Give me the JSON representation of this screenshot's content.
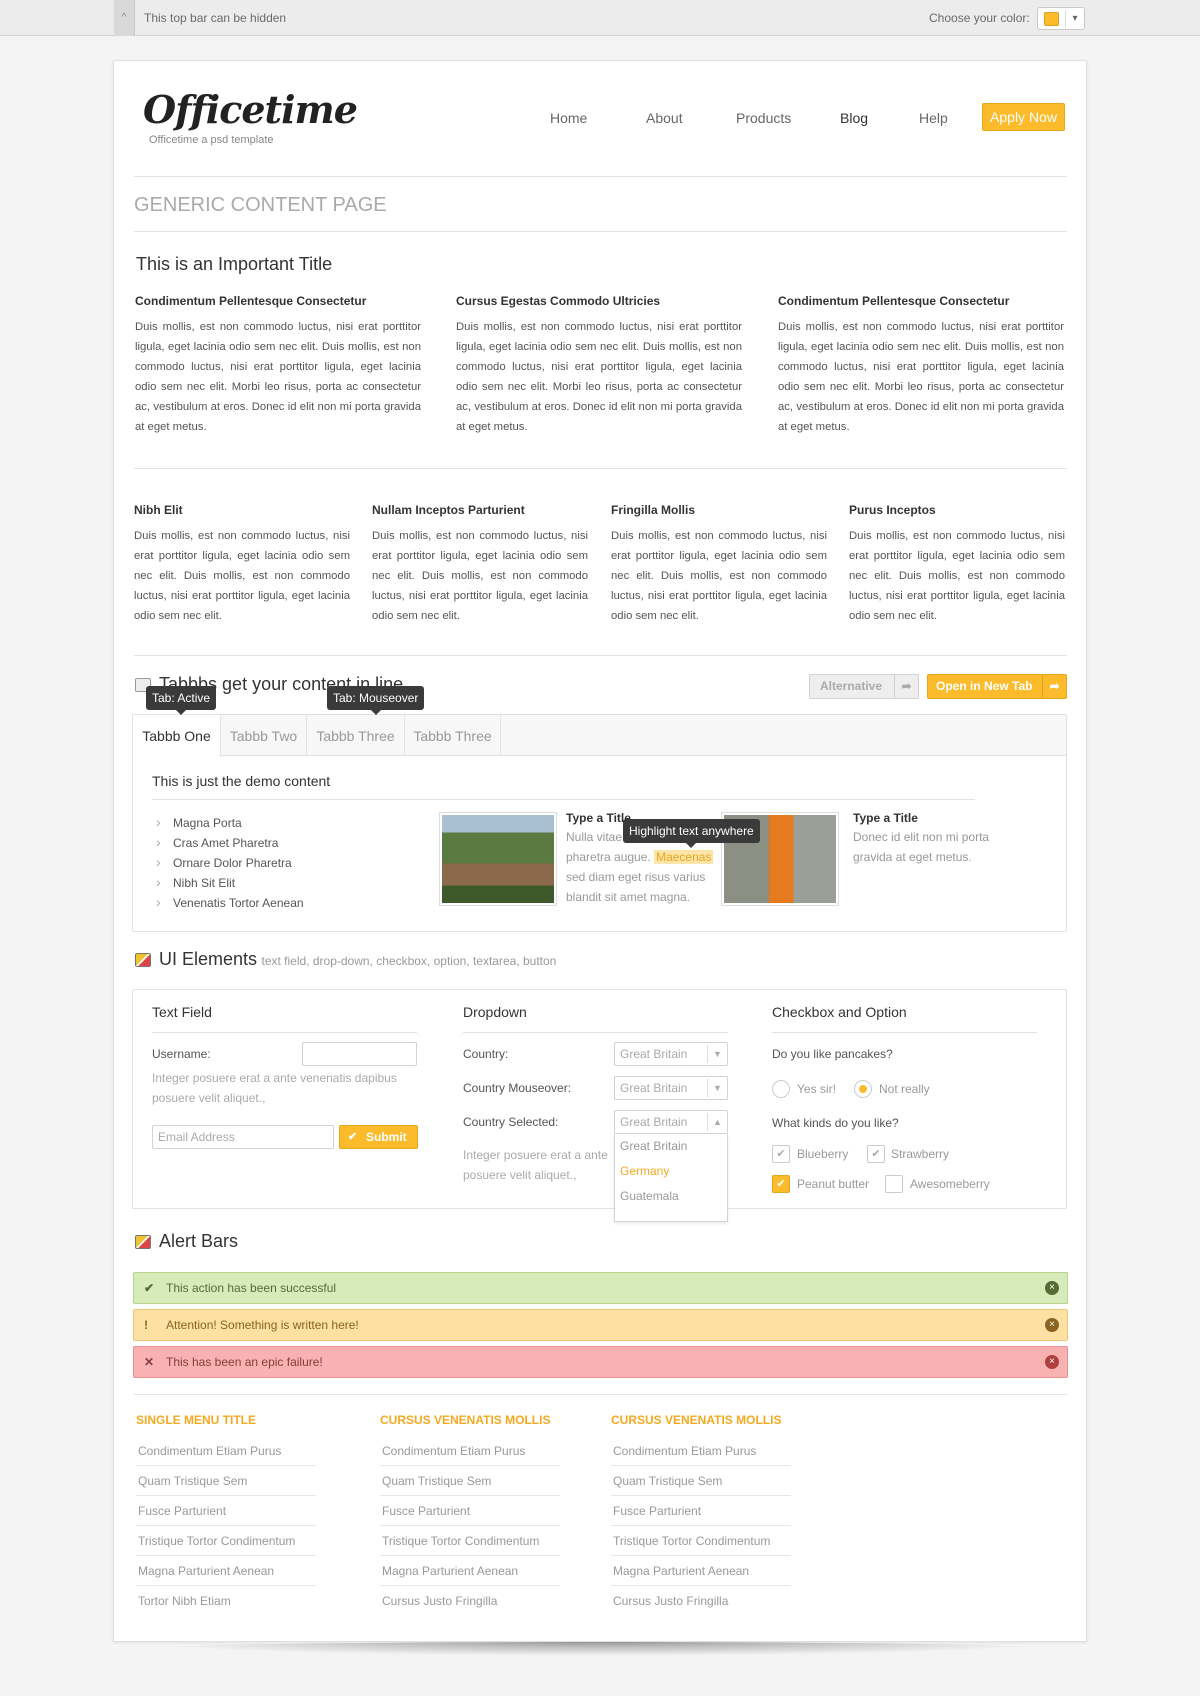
{
  "topbar": {
    "toggle_symbol": "^",
    "text": "This top bar can be hidden",
    "color_label": "Choose your color:",
    "color_value": "#fbbb2b"
  },
  "brand": {
    "name": "Officetime",
    "tagline": "Officetime a psd template"
  },
  "nav": {
    "items": [
      "Home",
      "About",
      "Products",
      "Blog",
      "Help"
    ],
    "active": "Blog",
    "cta": "Apply Now"
  },
  "page_title": "GENERIC CONTENT PAGE",
  "important_title": "This is an Important Title",
  "three_cols": [
    {
      "heading": "Condimentum Pellentesque Consectetur",
      "text": "Duis mollis, est non commodo luctus, nisi erat porttitor ligula, eget lacinia odio sem nec elit. Duis mollis, est non commodo luctus, nisi erat porttitor ligula, eget lacinia odio sem nec elit. Morbi leo risus, porta ac consectetur ac, vestibulum at eros. Donec id elit non mi porta gravida at eget metus."
    },
    {
      "heading": "Cursus Egestas Commodo Ultricies",
      "text": "Duis mollis, est non commodo luctus, nisi erat porttitor ligula, eget lacinia odio sem nec elit. Duis mollis, est non commodo luctus, nisi erat porttitor ligula, eget lacinia odio sem nec elit. Morbi leo risus, porta ac consectetur ac, vestibulum at eros. Donec id elit non mi porta gravida at eget metus."
    },
    {
      "heading": "Condimentum Pellentesque Consectetur",
      "text": "Duis mollis, est non commodo luctus, nisi erat porttitor ligula, eget lacinia odio sem nec elit. Duis mollis, est non commodo luctus, nisi erat porttitor ligula, eget lacinia odio sem nec elit. Morbi leo risus, porta ac consectetur ac, vestibulum at eros. Donec id elit non mi porta gravida at eget metus."
    }
  ],
  "four_cols": [
    {
      "heading": "Nibh Elit",
      "text": "Duis mollis, est non commodo luctus, nisi erat porttitor ligula, eget lacinia odio sem nec elit. Duis mollis, est non commodo luctus, nisi erat porttitor ligula, eget lacinia odio sem nec elit."
    },
    {
      "heading": "Nullam Inceptos Parturient",
      "text": "Duis mollis, est non commodo luctus, nisi erat porttitor ligula, eget lacinia odio sem nec elit. Duis mollis, est non commodo luctus, nisi erat porttitor ligula, eget lacinia odio sem nec elit."
    },
    {
      "heading": "Fringilla Mollis",
      "text": "Duis mollis, est non commodo luctus, nisi erat porttitor ligula, eget lacinia odio sem nec elit. Duis mollis, est non commodo luctus, nisi erat porttitor ligula, eget lacinia odio sem nec elit."
    },
    {
      "heading": "Purus Inceptos",
      "text": "Duis mollis, est non commodo luctus, nisi erat porttitor ligula, eget lacinia odio sem nec elit. Duis mollis, est non commodo luctus, nisi erat porttitor ligula, eget lacinia odio sem nec elit."
    }
  ],
  "tabs_section": {
    "title": "Tabbbs get your content in line",
    "alternative": "Alternative",
    "open_new_tab": "Open in New Tab",
    "tooltip_active": "Tab: Active",
    "tooltip_mouseover": "Tab: Mouseover",
    "tabs": [
      "Tabbb One",
      "Tabbb Two",
      "Tabbb Three",
      "Tabbb Three"
    ],
    "demo_heading": "This is just the demo content",
    "list": [
      "Magna Porta",
      "Cras Amet Pharetra",
      "Ornare Dolor Pharetra",
      "Nibh Sit Elit",
      "Venenatis Tortor Aenean"
    ],
    "media1": {
      "title": "Type a Title",
      "before": "Nulla vitae elit libero, a pharetra augue.",
      "highlight": "Maecenas",
      "after": "sed diam eget risus varius blandit sit amet magna."
    },
    "tooltip_highlight": "Highlight text anywhere",
    "media2": {
      "title": "Type a Title",
      "text": "Donec id elit non mi porta gravida at eget metus."
    }
  },
  "ui_section": {
    "title": "UI Elements",
    "subtitle": "text field, drop-down, checkbox, option, textarea, button",
    "text_field": {
      "heading": "Text Field",
      "username_label": "Username:",
      "username_value": "",
      "note": "Integer posuere erat a ante venenatis dapibus posuere velit aliquet.,",
      "email_placeholder": "Email Address",
      "submit": "Submit"
    },
    "dropdown": {
      "heading": "Dropdown",
      "country_label": "Country:",
      "country_mouseover_label": "Country Mouseover:",
      "country_selected_label": "Country Selected:",
      "value": "Great Britain",
      "options": [
        "Great Britain",
        "Germany",
        "Guatemala"
      ],
      "highlighted_option": "Germany",
      "note": "Integer posuere erat a ante posuere velit aliquet.,"
    },
    "checkbox": {
      "heading": "Checkbox and Option",
      "q1": "Do you like pancakes?",
      "radio1": "Yes sir!",
      "radio2": "Not really",
      "radio_selected": "Not really",
      "q2": "What kinds do you like?",
      "options": [
        "Blueberry",
        "Strawberry",
        "Peanut butter",
        "Awesomeberry"
      ],
      "checked": [
        "Blueberry",
        "Strawberry",
        "Peanut butter"
      ]
    }
  },
  "alerts": {
    "title": "Alert Bars",
    "success": "This action has been successful",
    "warning": "Attention! Something is written here!",
    "error": "This has been an epic failure!"
  },
  "footer_menus": [
    {
      "title": "SINGLE MENU TITLE",
      "items": [
        "Condimentum Etiam Purus",
        "Quam Tristique Sem",
        "Fusce Parturient",
        "Tristique Tortor Condimentum",
        "Magna Parturient Aenean",
        "Tortor Nibh Etiam"
      ]
    },
    {
      "title": "CURSUS VENENATIS MOLLIS",
      "items": [
        "Condimentum Etiam Purus",
        "Quam Tristique Sem",
        "Fusce Parturient",
        "Tristique Tortor Condimentum",
        "Magna Parturient Aenean",
        "Cursus Justo Fringilla"
      ]
    },
    {
      "title": "CURSUS VENENATIS MOLLIS",
      "items": [
        "Condimentum Etiam Purus",
        "Quam Tristique Sem",
        "Fusce Parturient",
        "Tristique Tortor Condimentum",
        "Magna Parturient Aenean",
        "Cursus Justo Fringilla"
      ]
    }
  ]
}
